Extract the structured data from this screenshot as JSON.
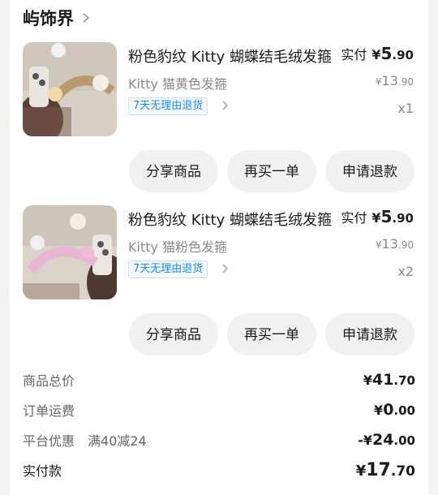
{
  "shop": {
    "name": "屿饰界"
  },
  "items": [
    {
      "title": "粉色豹纹 Kitty 蝴蝶结毛绒发箍",
      "paid_label": "实付",
      "paid_currency": "¥",
      "paid_int": "5",
      "paid_dec": ".90",
      "spec": "Kitty 猫黄色发箍",
      "orig_currency": "¥",
      "orig_int": "13",
      "orig_dec": ".90",
      "badge": "7天无理由退货",
      "qty": "x1",
      "buttons": [
        "分享商品",
        "再买一单",
        "申请退款"
      ]
    },
    {
      "title": "粉色豹纹 Kitty 蝴蝶结毛绒发箍",
      "paid_label": "实付",
      "paid_currency": "¥",
      "paid_int": "5",
      "paid_dec": ".90",
      "spec": "Kitty 猫粉色发箍",
      "orig_currency": "¥",
      "orig_int": "13",
      "orig_dec": ".90",
      "badge": "7天无理由退货",
      "qty": "x2",
      "buttons": [
        "分享商品",
        "再买一单",
        "申请退款"
      ]
    }
  ],
  "summary": {
    "goods_total": {
      "label": "商品总价",
      "cur": "¥",
      "int": "41",
      "dec": ".70"
    },
    "shipping": {
      "label": "订单运费",
      "cur": "¥",
      "int": "0",
      "dec": ".00"
    },
    "discount": {
      "label": "平台优惠",
      "detail": "满40减24",
      "cur": "-¥",
      "int": "24",
      "dec": ".00"
    },
    "paid": {
      "label": "实付款",
      "cur": "¥",
      "int": "17",
      "dec": ".70"
    }
  }
}
